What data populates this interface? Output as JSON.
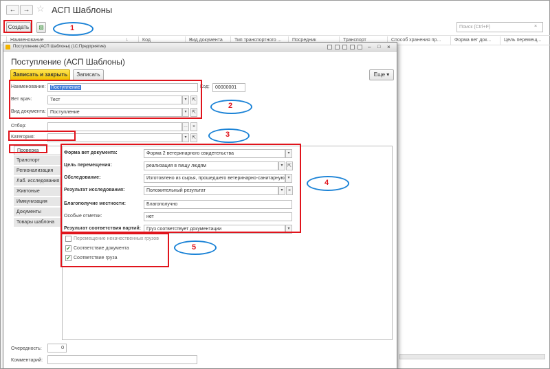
{
  "outer": {
    "title": "АСП Шаблоны",
    "create_button": "Создать",
    "search_placeholder": "Поиск (Ctrl+F)",
    "columns": [
      "Наименование",
      "Код",
      "Вид документа",
      "Тип транспортного ...",
      "Посредник",
      "Транспорт",
      "Способ хранения пр...",
      "Форма вет док...",
      "Цель перемещ..."
    ]
  },
  "inner_window": {
    "titlebar": "Поступление (АСП Шаблоны) (1С:Предприятие)",
    "titlebar_icons": [
      "save-icon",
      "print-icon",
      "copy-icon",
      "clip-icon",
      "calc-icon",
      "minimize-icon",
      "maximize-icon",
      "close-icon"
    ]
  },
  "form": {
    "title": "Поступление (АСП Шаблоны)",
    "save_close_button": "Записать и закрыть",
    "save_button": "Записать",
    "more_button": "Еще",
    "name_label": "Наименование:",
    "name_value": "Поступление",
    "code_label": "Код:",
    "code_value": "00000001",
    "vet_label": "Вет врач:",
    "vet_value": "Тест",
    "doc_type_label": "Вид документа:",
    "doc_type_value": "Поступление",
    "filter_label": "Отбор:",
    "filter_value": "",
    "category_label": "Категория:",
    "category_value": "",
    "priority_label": "Очередность:",
    "priority_value": "0",
    "comment_label": "Комментарий:",
    "comment_value": ""
  },
  "tabs": [
    {
      "label": "Проверка",
      "active": true
    },
    {
      "label": "Транспорт",
      "active": false
    },
    {
      "label": "Регионализация",
      "active": false
    },
    {
      "label": "Лаб. исследования",
      "active": false
    },
    {
      "label": "Живтоные",
      "active": false
    },
    {
      "label": "Иммунизация",
      "active": false
    },
    {
      "label": "Документы",
      "active": false
    },
    {
      "label": "Товары шаблона",
      "active": false
    }
  ],
  "check_panel": {
    "vet_doc_form_label": "Форма вет документа:",
    "vet_doc_form_value": "Форма 2 ветеринарного свидетельства",
    "movement_purpose_label": "Цель перемещения:",
    "movement_purpose_value": "реализация в пищу людям",
    "inspection_label": "Обследование:",
    "inspection_value": "Изготовлено из сырья, прошедшего ветеринарно-санитарную э",
    "research_result_label": "Результат исследования:",
    "research_result_value": "Положительный результат",
    "locality_label": "Благополучие местности:",
    "locality_value": "Благополучно",
    "notes_label": "Особые отметки:",
    "notes_value": "нет",
    "consignment_label": "Результат соответствия партий:",
    "consignment_value": "Груз соответствует документации"
  },
  "checkboxes": [
    {
      "label": "Перемещение некачественных грузов",
      "checked": false
    },
    {
      "label": "Соответствие документа",
      "checked": true
    },
    {
      "label": "Соответствие груза",
      "checked": true
    }
  ],
  "annotations": [
    "1",
    "2",
    "3",
    "4",
    "5"
  ]
}
